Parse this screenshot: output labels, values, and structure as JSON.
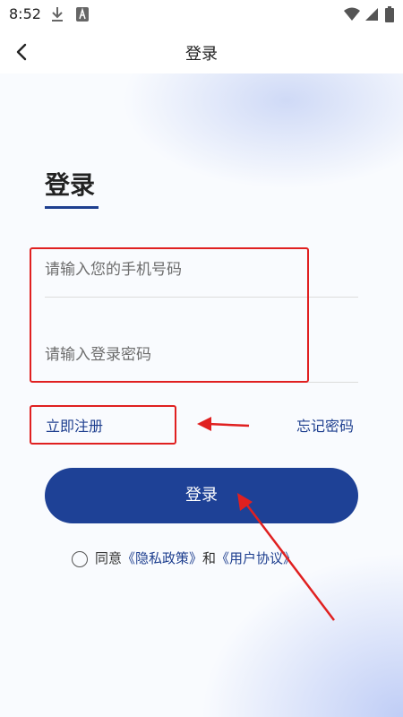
{
  "status_bar": {
    "time": "8:52"
  },
  "app_bar": {
    "title": "登录"
  },
  "login": {
    "heading": "登录",
    "phone_placeholder": "请输入您的手机号码",
    "password_placeholder": "请输入登录密码",
    "register_link": "立即注册",
    "forgot_link": "忘记密码",
    "submit_label": "登录"
  },
  "agreement": {
    "prefix": "同意",
    "privacy_policy": "《隐私政策》",
    "conjunction": "和",
    "user_agreement": "《用户协议》"
  },
  "colors": {
    "brand": "#1e4196",
    "annotation": "#e02020"
  },
  "icons": [
    "download-icon",
    "a-icon",
    "wifi-icon",
    "signal-icon",
    "battery-icon",
    "back-arrow-icon",
    "radio-unchecked-icon"
  ]
}
